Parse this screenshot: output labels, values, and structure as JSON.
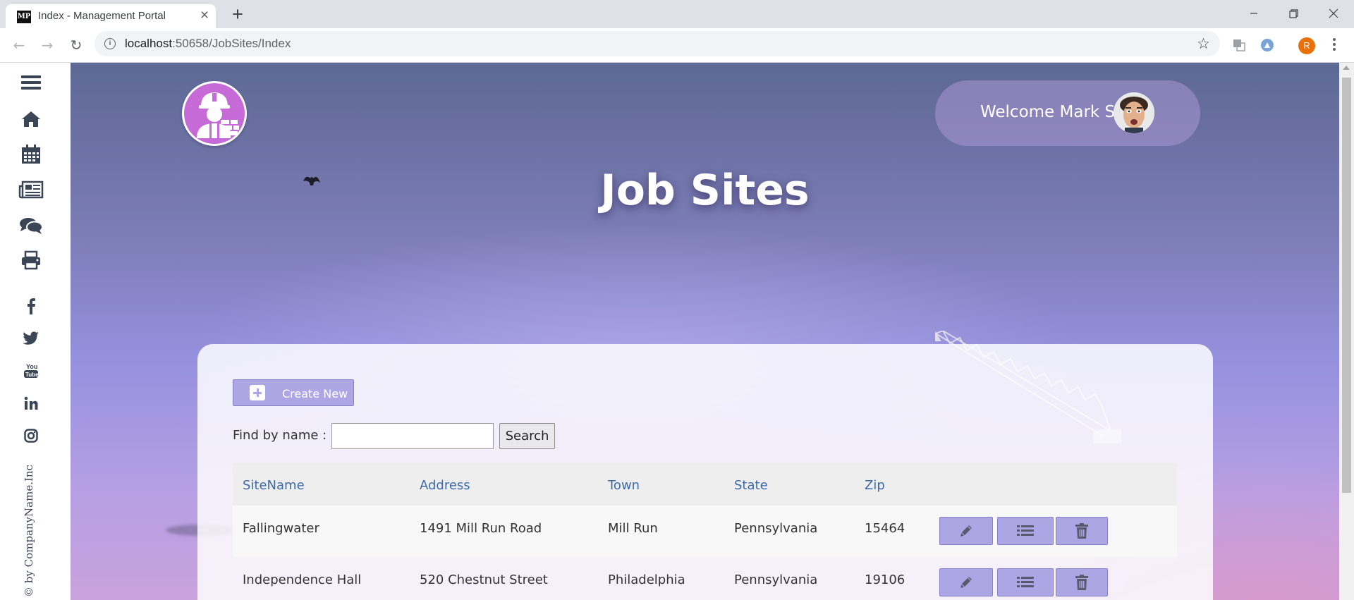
{
  "browser": {
    "tab_title": "Index - Management Portal",
    "tab_favicon_text": "MP",
    "url_host": "localhost",
    "url_rest": ":50658/JobSites/Index",
    "profile_initial": "R"
  },
  "sidebar": {
    "items": [
      "menu-icon",
      "home-icon",
      "calendar-icon",
      "news-icon",
      "comments-icon",
      "print-icon"
    ],
    "social": [
      "facebook-icon",
      "twitter-icon",
      "youtube-icon",
      "linkedin-icon",
      "instagram-icon"
    ],
    "copyright": "© by CompanyName.Inc"
  },
  "header": {
    "welcome": "Welcome Mark S",
    "title": "Job Sites"
  },
  "toolbar": {
    "create_label": "Create New",
    "find_label": "Find by name :",
    "search_value": "",
    "search_button": "Search"
  },
  "table": {
    "columns": [
      "SiteName",
      "Address",
      "Town",
      "State",
      "Zip"
    ],
    "rows": [
      [
        "Fallingwater",
        "1491 Mill Run Road",
        "Mill Run",
        "Pennsylvania",
        "15464"
      ],
      [
        "Independence Hall",
        "520 Chestnut Street",
        "Philadelphia",
        "Pennsylvania",
        "19106"
      ]
    ],
    "row_actions": [
      "edit-icon",
      "details-icon",
      "delete-icon"
    ]
  },
  "colors": {
    "accent": "#aca7e4",
    "logo": "#c66ad8",
    "header_link": "#3d6aa6",
    "sidebar_icon": "#3a4556"
  }
}
